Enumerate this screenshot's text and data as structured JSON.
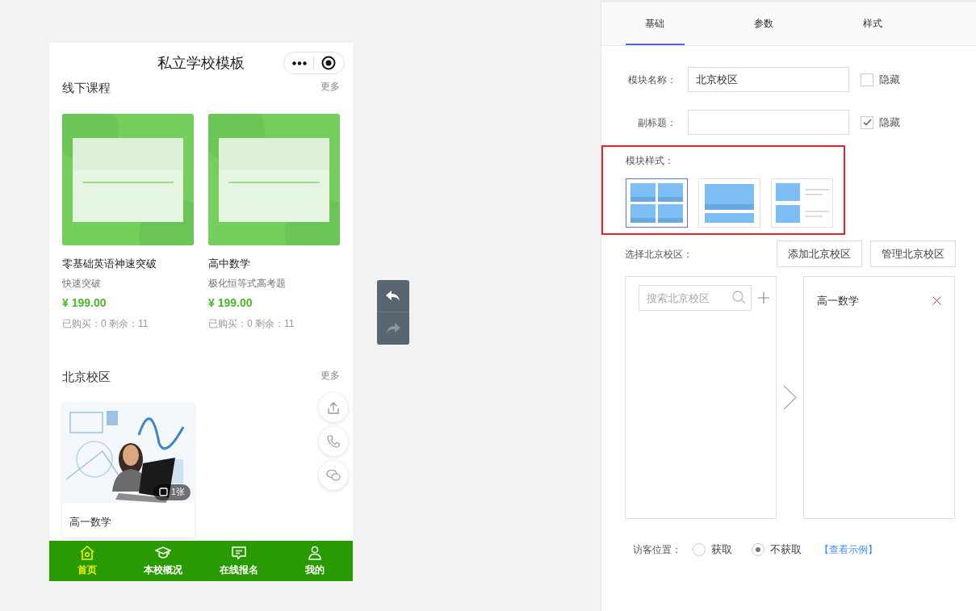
{
  "phone": {
    "title": "私立学校模板",
    "sections": [
      {
        "kind": "courses",
        "title": "线下课程",
        "more": "更多",
        "items": [
          {
            "title": "零基础英语神速突破",
            "subtitle": "快速突破",
            "price": "¥ 199.00",
            "stats": "已购买：0 剩余：11"
          },
          {
            "title": "高中数学",
            "subtitle": "极化恒等式高考题",
            "price": "¥ 199.00",
            "stats": "已购买：0 剩余：11"
          }
        ]
      },
      {
        "kind": "gallery",
        "title": "北京校区",
        "more": "更多",
        "items": [
          {
            "title": "高一数学",
            "count": "1张"
          }
        ]
      }
    ],
    "tabbar": [
      {
        "label": "首页",
        "kind": "home",
        "selected": true
      },
      {
        "label": "本校概况",
        "kind": "cap",
        "selected": false
      },
      {
        "label": "在线报名",
        "kind": "chat",
        "selected": false
      },
      {
        "label": "我的",
        "kind": "user",
        "selected": false
      }
    ]
  },
  "editor": {
    "tabs": [
      {
        "label": "基础",
        "selected": true
      },
      {
        "label": "参数",
        "selected": false
      },
      {
        "label": "样式",
        "selected": false
      }
    ],
    "fields": [
      {
        "label": "模块名称：",
        "value": "北京校区",
        "hide_label": "隐藏",
        "hidden": false
      },
      {
        "label": "副标题：",
        "hide_label": "隐藏",
        "hidden": true
      }
    ],
    "style_label": "模块样式：",
    "styles": [
      {
        "kind": "grid",
        "selected": true
      },
      {
        "kind": "banner",
        "selected": false
      },
      {
        "kind": "list",
        "selected": false
      }
    ],
    "picker": {
      "label": "选择北京校区：",
      "buttons": [
        "添加北京校区",
        "管理北京校区"
      ],
      "search_placeholder": "搜索北京校区",
      "selected_items": [
        {
          "label": "高一数学"
        }
      ]
    },
    "location": {
      "label": "访客位置：",
      "options": [
        {
          "label": "获取",
          "selected": false
        },
        {
          "label": "不获取",
          "selected": true
        }
      ],
      "link": "【查看示例】"
    }
  }
}
